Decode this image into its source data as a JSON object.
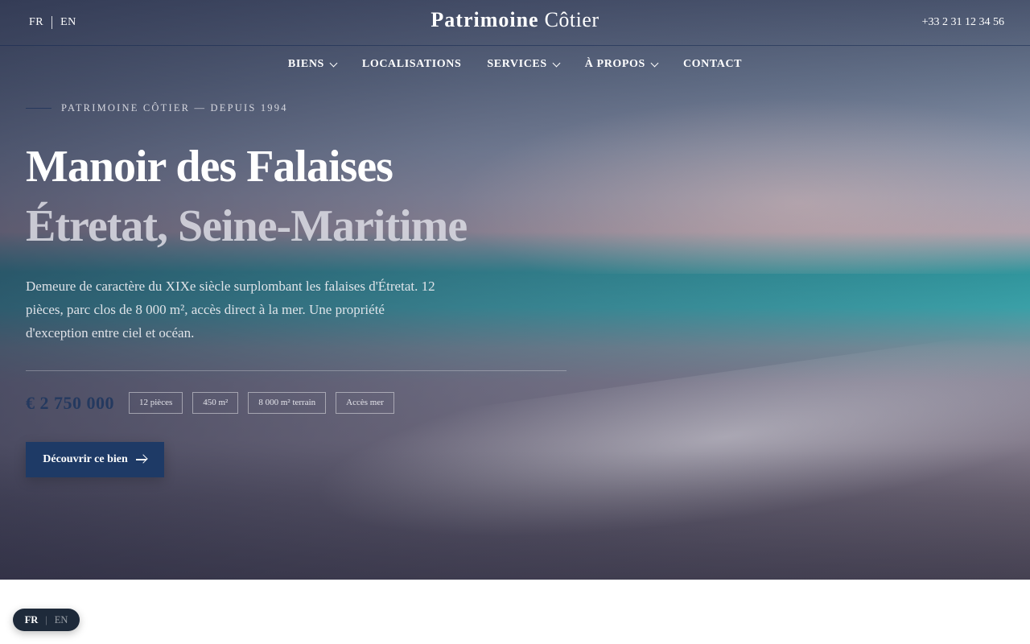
{
  "header": {
    "lang_active": "FR",
    "lang_other": "EN",
    "brand_bold": "Patrimoine",
    "brand_light": "Côtier",
    "phone": "+33 2 31 12 34 56"
  },
  "nav": {
    "items": [
      {
        "label": "BIENS",
        "has_dropdown": true
      },
      {
        "label": "LOCALISATIONS",
        "has_dropdown": false
      },
      {
        "label": "SERVICES",
        "has_dropdown": true
      },
      {
        "label": "À PROPOS",
        "has_dropdown": true
      },
      {
        "label": "CONTACT",
        "has_dropdown": false
      }
    ]
  },
  "hero": {
    "eyebrow": "PATRIMOINE CÔTIER — DEPUIS 1994",
    "title": "Manoir des Falaises",
    "subtitle": "Étretat, Seine-Maritime",
    "description": "Demeure de caractère du XIXe siècle surplombant les falaises d'Étretat. 12 pièces, parc clos de 8 000 m², accès direct à la mer. Une propriété d'exception entre ciel et océan.",
    "price": "€ 2 750 000",
    "tags": [
      "12 pièces",
      "450 m²",
      "8 000 m² terrain",
      "Accès mer"
    ],
    "cta_label": "Découvrir ce bien"
  },
  "lang_switcher": {
    "active": "FR",
    "other": "EN"
  },
  "colors": {
    "accent": "#1e3a66",
    "price": "#24395f",
    "pill_bg": "#1e2a3a"
  }
}
